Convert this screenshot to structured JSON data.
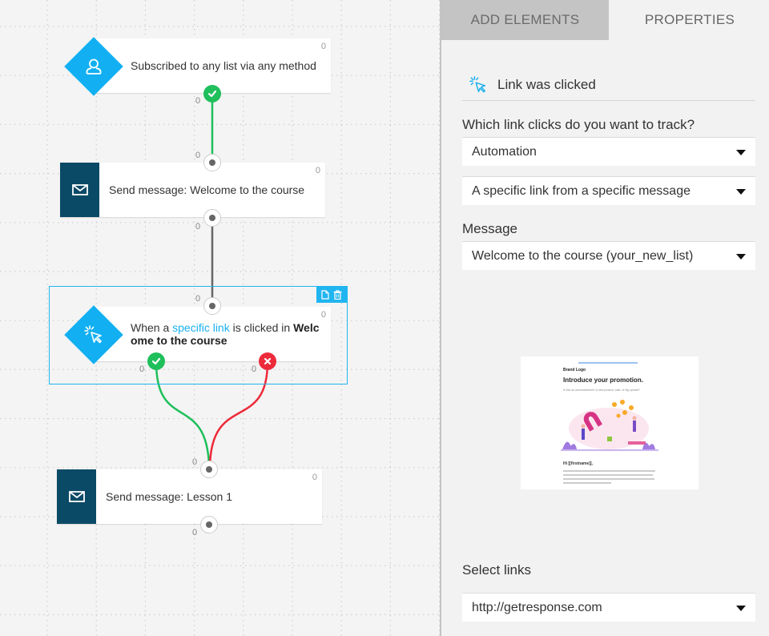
{
  "canvas": {
    "nodes": [
      {
        "id": "trigger-subscribed",
        "type": "condition",
        "icon": "user-icon",
        "text": "Subscribed to any list via any method",
        "count": "0",
        "out_ok_count": "0"
      },
      {
        "id": "action-welcome",
        "type": "action",
        "icon": "envelope-icon",
        "text": "Send message: Welcome to the course",
        "count": "0",
        "in_count": "0",
        "out_count": "0"
      },
      {
        "id": "condition-link-clicked",
        "type": "condition",
        "icon": "cursor-click-icon",
        "text_prefix": "When a ",
        "text_link": "specific link",
        "text_middle": " is clicked in ",
        "text_bold": "Welcome to the course",
        "count": "0",
        "in_count": "0",
        "out_ok_count": "0",
        "out_no_count": "0",
        "selected": true
      },
      {
        "id": "action-lesson1",
        "type": "action",
        "icon": "envelope-icon",
        "text": "Send message: Lesson 1",
        "count": "0",
        "in_count": "0",
        "out_count": "0"
      }
    ],
    "selection_toolbar": [
      "copy-icon",
      "trash-icon"
    ],
    "colors": {
      "condition": "#12b0f2",
      "action": "#0b4a66",
      "yes": "#1fbf5b",
      "no": "#ed2a3a",
      "link": "#1ab0ee"
    }
  },
  "panel": {
    "tabs": [
      {
        "label": "ADD ELEMENTS",
        "active": false
      },
      {
        "label": "PROPERTIES",
        "active": true
      }
    ],
    "header": {
      "icon": "cursor-click-icon",
      "title": "Link was clicked"
    },
    "track_label": "Which link clicks do you want to track?",
    "track_source": "Automation",
    "track_type": "A specific link from a specific message",
    "message_label": "Message",
    "message_value": "Welcome to the course (your_new_list)",
    "preview": {
      "brand": "Brand Logo",
      "title": "Introduce your promotion.",
      "subtitle": "Is this an announcement? A new product, sale, or big update?",
      "greeting": "Hi [[firstname]],"
    },
    "links_label": "Select links",
    "links_value": "http://getresponse.com"
  }
}
